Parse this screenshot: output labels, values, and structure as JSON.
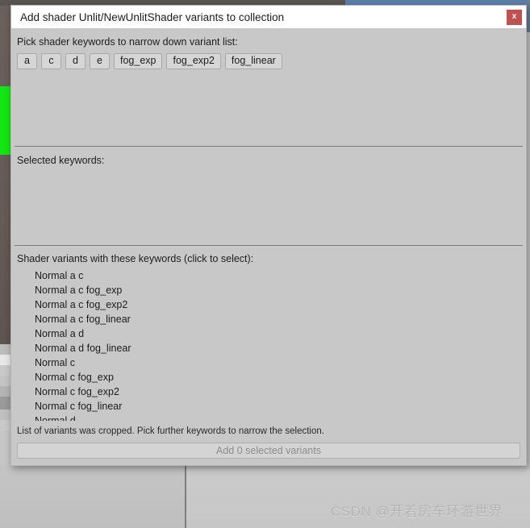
{
  "window": {
    "title": "Add shader Unlit/NewUnlitShader variants to collection",
    "close_label": "x"
  },
  "keywords_section": {
    "label": "Pick shader keywords to narrow down variant list:",
    "chips": [
      "a",
      "c",
      "d",
      "e",
      "fog_exp",
      "fog_exp2",
      "fog_linear"
    ]
  },
  "selected_section": {
    "label": "Selected keywords:",
    "chips": []
  },
  "variants_section": {
    "label": "Shader variants with these keywords (click to select):",
    "items": [
      "Normal a c",
      "Normal a c fog_exp",
      "Normal a c fog_exp2",
      "Normal a c fog_linear",
      "Normal a d",
      "Normal a d fog_linear",
      "Normal c",
      "Normal c fog_exp",
      "Normal c fog_exp2",
      "Normal c fog_linear",
      "Normal d"
    ],
    "crop_note": "List of variants was cropped. Pick further keywords to narrow the selection."
  },
  "footer": {
    "add_button_label": "Add 0 selected variants"
  },
  "background": {
    "watermark": "CSDN @开着房车环游世界",
    "row_colors": [
      "#bcbcbc",
      "#e8e8e8",
      "#cacaca",
      "#c4c4c4",
      "#b4b4b4",
      "#9a9a9a",
      "#c0c0c0",
      "#c9c9c9"
    ]
  },
  "colors": {
    "dialog_bg": "#c8c8c8",
    "titlebar_bg": "#ffffff",
    "close_red": "#bf5151",
    "chip_bg": "#d6d6d6",
    "divider": "#7d7d7d",
    "disabled_text": "#8d8d8d",
    "scene_green": "#14e514",
    "top_blue": "#5d80ab"
  }
}
